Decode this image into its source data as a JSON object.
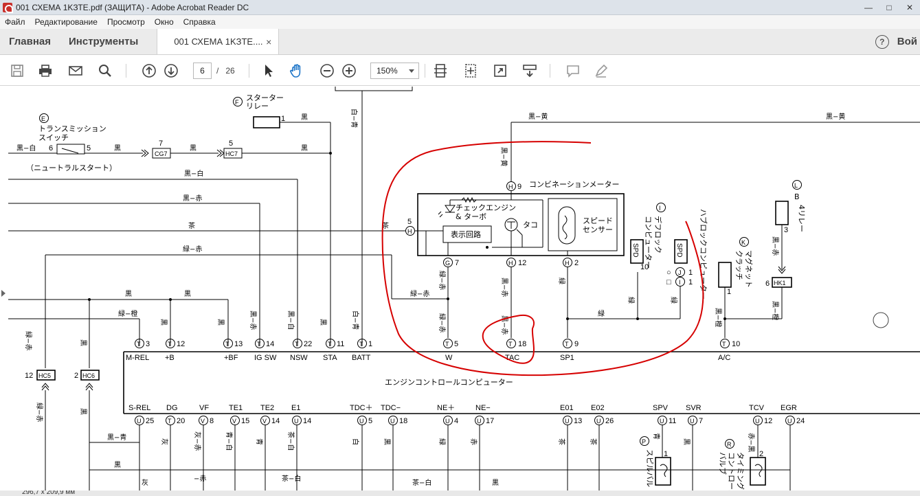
{
  "window": {
    "title": "001 СХЕМА 1KЗТЕ.pdf (ЗАЩИТА) - Adobe Acrobat Reader DC",
    "minimize": "—",
    "maximize": "□",
    "close": "✕"
  },
  "menu": [
    "Файл",
    "Редактирование",
    "Просмотр",
    "Окно",
    "Справка"
  ],
  "tabs": {
    "home": "Главная",
    "tools": "Инструменты",
    "document": "001 СХЕМА 1KЗTE....",
    "close": "×",
    "help": "?",
    "signin": "Вой"
  },
  "toolbar": {
    "page_current": "6",
    "page_separator": "/",
    "page_total": "26",
    "zoom": "150%",
    "icons": [
      "save-icon",
      "print-icon",
      "email-icon",
      "search-icon",
      "prev-page-icon",
      "next-page-icon",
      "select-cursor-icon",
      "hand-tool-icon",
      "zoom-out-icon",
      "zoom-in-icon",
      "scroll-mode-icon",
      "fit-page-icon",
      "full-screen-icon",
      "read-mode-icon",
      "comment-icon",
      "highlight-icon"
    ]
  },
  "diagram": {
    "labels": {
      "E": "E",
      "E_name1": "トランスミッション",
      "E_name2": "スイッチ",
      "E_sub": "（ニュートラルスタート）",
      "F": "F",
      "F_name1": "スターター",
      "F_name2": "リレー",
      "I": "I",
      "I_name1": "デフロック",
      "I_name2": "コンピューター",
      "K": "K",
      "K_name1": "マグネット",
      "K_name2": "クラッチ",
      "L": "L",
      "L_name1": "B",
      "L_name2": "4リレー",
      "P": "P",
      "P_name": "スピルバル",
      "R": "R",
      "R_name1": "タイミング",
      "R_name2": "コントロール",
      "R_name3": "バルブ",
      "hub": "ハブロックコンピューター",
      "meter": "コンビネーションメーター",
      "check": "チェックエンジン",
      "turbo": "& ターボ",
      "display": "表示回路",
      "tach": "タコ",
      "speed1": "スピード",
      "speed2": "センサー",
      "ecu": "エンジンコントロールコンピューター",
      "spd": "SPD",
      "r_circle": "○",
      "r_square": "□"
    },
    "wires": {
      "kuro_shiro": "黒−白",
      "kuro": "黒",
      "kuro_aka": "黒−赤",
      "cha": "茶",
      "midori_aka": "緑−赤",
      "kuro_ki": "黒−黄",
      "shiro_ao": "白−青",
      "midori_dai": "緑−橙",
      "kuro_dai": "黒−橙",
      "midori": "緑",
      "kuro_ao": "黒−青",
      "hai": "灰",
      "hai_aka": "灰−赤",
      "ao_shiro": "青−白",
      "ao": "青",
      "cha_shiro": "茶−白",
      "shiro": "白",
      "aka": "赤",
      "aka_kuro": "赤−黒",
      "kuro_shiro2": "黒−白",
      "aka_dash": "−赤",
      "cha_shiro2": "茶−白"
    },
    "top_pins": [
      {
        "conn": "T",
        "num": "3",
        "name": "M-REL"
      },
      {
        "conn": "T",
        "num": "12",
        "name": "+B"
      },
      {
        "conn": "T",
        "num": "13",
        "name": "+BF"
      },
      {
        "conn": "T",
        "num": "14",
        "name": "IG SW"
      },
      {
        "conn": "T",
        "num": "22",
        "name": "NSW"
      },
      {
        "conn": "T",
        "num": "11",
        "name": "STA"
      },
      {
        "conn": "T",
        "num": "1",
        "name": "BATT"
      },
      {
        "conn": "T",
        "num": "5",
        "name": "W"
      },
      {
        "conn": "T",
        "num": "18",
        "name": "TAC"
      },
      {
        "conn": "T",
        "num": "9",
        "name": "SP1"
      },
      {
        "conn": "T",
        "num": "10",
        "name": "A/C"
      }
    ],
    "bottom_pins": [
      {
        "conn": "U",
        "num": "25",
        "name": "S-REL"
      },
      {
        "conn": "T",
        "num": "20",
        "name": "DG"
      },
      {
        "conn": "V",
        "num": "8",
        "name": "VF"
      },
      {
        "conn": "V",
        "num": "15",
        "name": "TE1"
      },
      {
        "conn": "V",
        "num": "14",
        "name": "TE2"
      },
      {
        "conn": "U",
        "num": "14",
        "name": "E1"
      },
      {
        "conn": "U",
        "num": "5",
        "name": "TDC＋"
      },
      {
        "conn": "U",
        "num": "18",
        "name": "TDC−"
      },
      {
        "conn": "U",
        "num": "4",
        "name": "NE＋"
      },
      {
        "conn": "U",
        "num": "17",
        "name": "NE−"
      },
      {
        "conn": "U",
        "num": "13",
        "name": "E01"
      },
      {
        "conn": "U",
        "num": "26",
        "name": "E02"
      },
      {
        "conn": "U",
        "num": "11",
        "name": "SPV"
      },
      {
        "conn": "U",
        "num": "7",
        "name": "SVR"
      },
      {
        "conn": "U",
        "num": "12",
        "name": "TCV"
      },
      {
        "conn": "U",
        "num": "24",
        "name": "EGR"
      }
    ],
    "connectors": {
      "cg7": "CG7",
      "hc7": "HC7",
      "hc5": "HC5",
      "hc6": "HC6",
      "hk1": "HK1",
      "pin_h": "H",
      "pin_g": "G",
      "pin_i": "I",
      "pin_j": "J"
    },
    "numbers": {
      "n1": "1",
      "n2": "2",
      "n3": "3",
      "n5": "5",
      "n6": "6",
      "n7": "7",
      "n9": "9",
      "n10": "10",
      "n12": "12"
    }
  },
  "status": {
    "size": "296,7 x 209,9 мм"
  }
}
